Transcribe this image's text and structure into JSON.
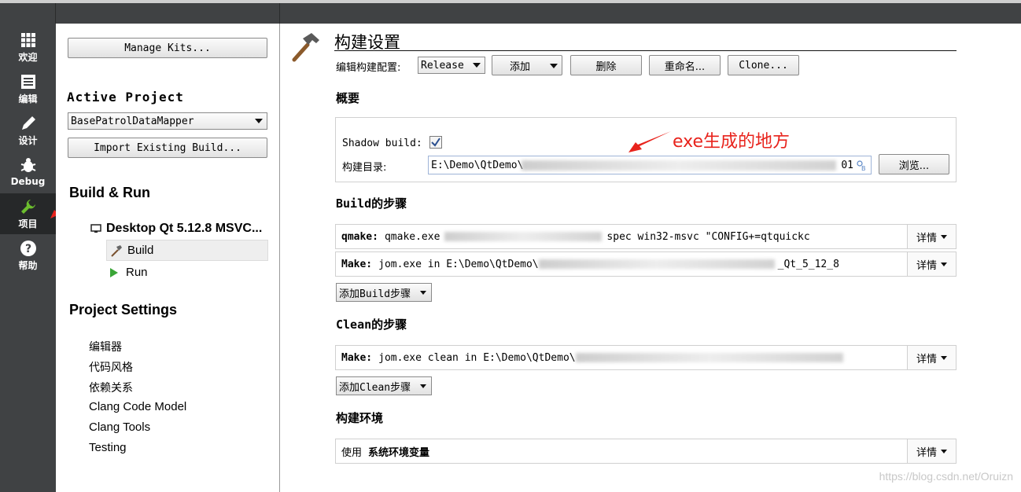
{
  "modes": [
    {
      "label": "欢迎",
      "icon": "grid-icon"
    },
    {
      "label": "编辑",
      "icon": "document-icon"
    },
    {
      "label": "设计",
      "icon": "pencil-icon"
    },
    {
      "label": "Debug",
      "icon": "bug-icon"
    },
    {
      "label": "项目",
      "icon": "wrench-icon",
      "active": true
    },
    {
      "label": "帮助",
      "icon": "help-icon"
    }
  ],
  "sidebar": {
    "manage_kits": "Manage Kits...",
    "active_project_title": "Active Project",
    "project_selected": "BasePatrolDataMapper",
    "import_build": "Import Existing Build...",
    "build_run_title": "Build & Run",
    "kit_name": "Desktop Qt 5.12.8 MSVC...",
    "build_item": "Build",
    "run_item": "Run",
    "project_settings_title": "Project Settings",
    "settings_items": [
      "编辑器",
      "代码风格",
      "依赖关系",
      "Clang Code Model",
      "Clang Tools",
      "Testing"
    ]
  },
  "main": {
    "title": "构建设置",
    "edit_config_label": "编辑构建配置:",
    "config_selected": "Release",
    "add_button": "添加",
    "delete_button": "删除",
    "rename_button": "重命名...",
    "clone_button": "Clone...",
    "overview_title": "概要",
    "shadow_build_label": "Shadow build:",
    "build_dir_label": "构建目录:",
    "build_dir_value": "E:\\Demo\\QtDemo\\",
    "build_dir_tail": "01",
    "browse_button": "浏览...",
    "annotation": "exe生成的地方",
    "build_steps_title": "Build的步骤",
    "build_steps": [
      {
        "tool": "qmake:",
        "cmd": "qmake.exe",
        "tail": "spec win32-msvc \"CONFIG+=qtquickc"
      },
      {
        "tool": "Make:",
        "cmd": "jom.exe in E:\\Demo\\QtDemo\\",
        "tail": "_Qt_5_12_8"
      }
    ],
    "add_build_step": "添加Build步骤",
    "clean_steps_title": "Clean的步骤",
    "clean_steps": [
      {
        "tool": "Make:",
        "cmd": "jom.exe clean in E:\\Demo\\QtDemo\\"
      }
    ],
    "add_clean_step": "添加Clean步骤",
    "env_title": "构建环境",
    "env_prefix": "使用",
    "env_value": "系统环境变量",
    "details_label": "详情"
  },
  "watermark": "https://blog.csdn.net/Oruizn",
  "colors": {
    "modebar": "#404244",
    "active_mode": "#262829",
    "arrow": "#e8231c",
    "annotation": "#e8231c"
  }
}
